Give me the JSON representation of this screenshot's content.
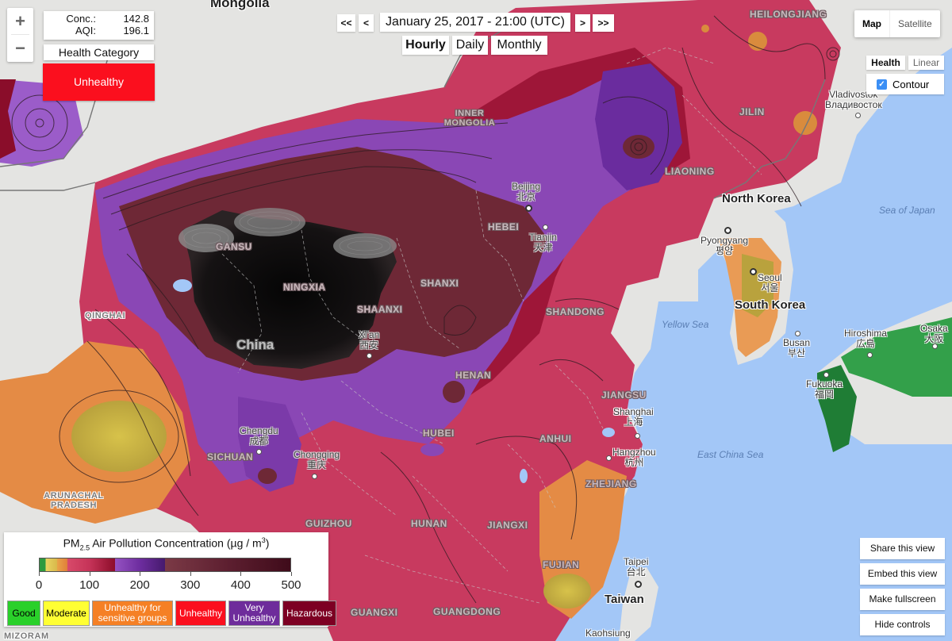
{
  "readout": {
    "conc_label": "Conc.:",
    "conc_value": "142.8",
    "aqi_label": "AQI:",
    "aqi_value": "196.1",
    "health_category_label": "Health Category",
    "health_category_value": "Unhealthy",
    "health_category_color": "#fb0f1e"
  },
  "zoom": {
    "in": "+",
    "out": "−"
  },
  "time_nav": {
    "first": "<<",
    "prev": "<",
    "datetime": "January 25, 2017 - 21:00 (UTC)",
    "next": ">",
    "last": ">>",
    "periods": [
      {
        "label": "Hourly",
        "active": true
      },
      {
        "label": "Daily",
        "active": false
      },
      {
        "label": "Monthly",
        "active": false
      }
    ]
  },
  "map_type": {
    "options": [
      "Map",
      "Satellite"
    ],
    "selected": "Map"
  },
  "color_scale": {
    "options": [
      "Health",
      "Linear"
    ],
    "selected": "Health"
  },
  "contour": {
    "label": "Contour",
    "checked": true
  },
  "side_buttons": [
    "Share this view",
    "Embed this view",
    "Make fullscreen",
    "Hide controls"
  ],
  "legend": {
    "title_main": "PM",
    "title_sub": "2.5",
    "title_rest": " Air Pollution Concentration (µg / m",
    "title_sup": "3",
    "title_end": ")",
    "ticks": [
      "0",
      "100",
      "200",
      "300",
      "400",
      "500"
    ],
    "scale_range": [
      0,
      500
    ],
    "categories": [
      {
        "label": "Good",
        "color": "#2ad02a",
        "text_color": "#000"
      },
      {
        "label": "Moderate",
        "color": "#ffff33",
        "text_color": "#000"
      },
      {
        "label": "Unhealthy for sensitive groups",
        "color": "#f58025",
        "text_color": "#fff"
      },
      {
        "label": "Unhealthy",
        "color": "#fb0f1e",
        "text_color": "#fff"
      },
      {
        "label": "Very Unhealthy",
        "color": "#6e2c9b",
        "text_color": "#fff"
      },
      {
        "label": "Hazardous",
        "color": "#7d0023",
        "text_color": "#fff"
      }
    ]
  },
  "map_labels": {
    "countries": [
      "Mongolia",
      "China",
      "North Korea",
      "South Korea",
      "Taiwan"
    ],
    "provinces": [
      "HEILONGJIANG",
      "INNER MONGOLIA",
      "JILIN",
      "LIAONING",
      "GANSU",
      "NINGXIA",
      "SHAANXI",
      "SHANXI",
      "HEBEI",
      "SHANDONG",
      "QINGHAI",
      "HENAN",
      "JIANGSU",
      "HUBEI",
      "ANHUI",
      "SICHUAN",
      "ZHEJIANG",
      "GUIZHOU",
      "HUNAN",
      "JIANGXI",
      "FUJIAN",
      "GUANGXI",
      "GUANGDONG",
      "ARUNACHAL PRADESH",
      "MIZORAM"
    ],
    "cities": [
      {
        "name": "Beijing",
        "local": "北京"
      },
      {
        "name": "Tianjin",
        "local": "天津"
      },
      {
        "name": "Xi'an",
        "local": "西安"
      },
      {
        "name": "Chengdu",
        "local": "成都"
      },
      {
        "name": "Chongqing",
        "local": "重庆"
      },
      {
        "name": "Shanghai",
        "local": "上海"
      },
      {
        "name": "Hangzhou",
        "local": "杭州"
      },
      {
        "name": "Taipei",
        "local": "台北"
      },
      {
        "name": "Kaohsiung",
        "local": ""
      },
      {
        "name": "Vladivostok",
        "local": "Владивосток"
      },
      {
        "name": "Pyongyang",
        "local": "평양"
      },
      {
        "name": "Seoul",
        "local": "서울"
      },
      {
        "name": "Busan",
        "local": "부산"
      },
      {
        "name": "Fukuoka",
        "local": "福岡"
      },
      {
        "name": "Hiroshima",
        "local": "広島"
      },
      {
        "name": "Osaka",
        "local": "大阪"
      }
    ],
    "seas": [
      "Sea of Japan",
      "Yellow Sea",
      "East China Sea"
    ]
  }
}
